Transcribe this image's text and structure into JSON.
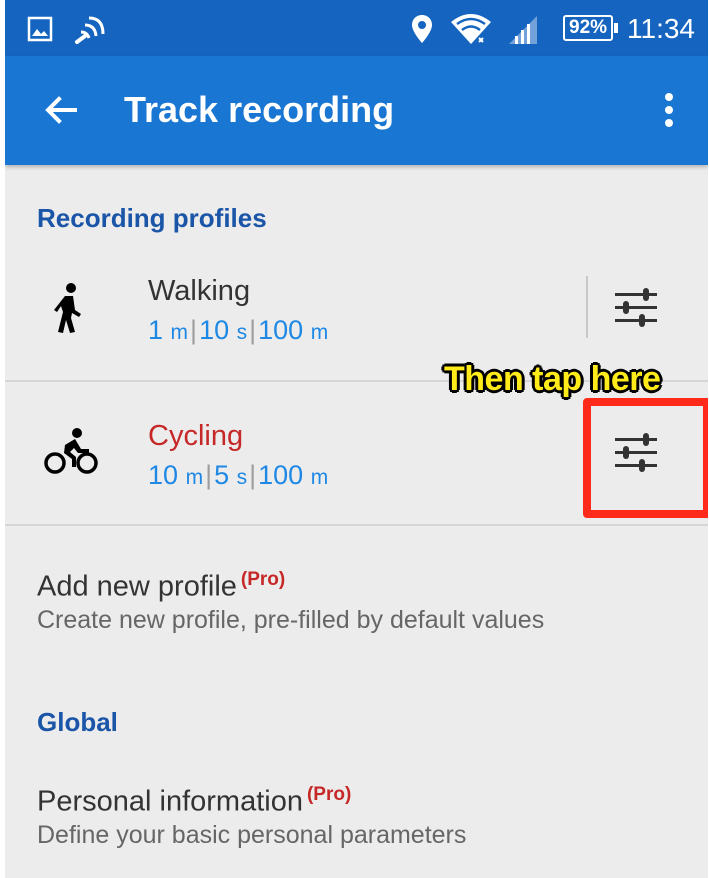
{
  "status_bar": {
    "battery": "92%",
    "time": "11:34",
    "icons": [
      "image-icon",
      "cast-icon",
      "location-icon",
      "wifi-icon",
      "signal-icon",
      "battery-icon"
    ]
  },
  "app_bar": {
    "title": "Track recording",
    "back_icon": "arrow-back-icon",
    "menu_icon": "more-vert-icon"
  },
  "sections": {
    "recording_profiles": "Recording profiles",
    "global": "Global"
  },
  "profiles": [
    {
      "name": "Walking",
      "name_color": "#333333",
      "icon": "walking-icon",
      "distance": "1",
      "distance_unit": "m",
      "time": "10",
      "time_unit": "s",
      "accuracy": "100",
      "accuracy_unit": "m"
    },
    {
      "name": "Cycling",
      "name_color": "#c62828",
      "icon": "cycling-icon",
      "distance": "10",
      "distance_unit": "m",
      "time": "5",
      "time_unit": "s",
      "accuracy": "100",
      "accuracy_unit": "m"
    }
  ],
  "add_profile": {
    "title": "Add new profile",
    "badge": "(Pro)",
    "summary": "Create new profile, pre-filled by default values"
  },
  "personal_info": {
    "title": "Personal information",
    "badge": "(Pro)",
    "summary": "Define your basic personal parameters"
  },
  "annotation": {
    "text": "Then tap here",
    "box_color": "#ff2a1a",
    "text_color": "#ffeb1a"
  },
  "colors": {
    "status_bar": "#1565c0",
    "app_bar": "#1976d2",
    "section_header": "#1a55a8",
    "detail_value": "#1e88e5",
    "pro_badge": "#c62828"
  }
}
